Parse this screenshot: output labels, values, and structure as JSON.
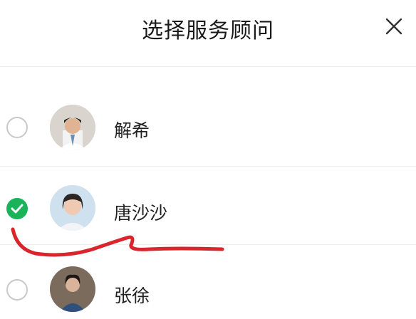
{
  "header": {
    "title": "选择服务顾问",
    "close_icon": "close-icon"
  },
  "consultants": [
    {
      "name": "解希",
      "selected": false
    },
    {
      "name": "唐沙沙",
      "selected": true
    },
    {
      "name": "张徐",
      "selected": false
    }
  ],
  "colors": {
    "selected_accent": "#19b35a",
    "annotation_stroke": "#d8262c"
  }
}
